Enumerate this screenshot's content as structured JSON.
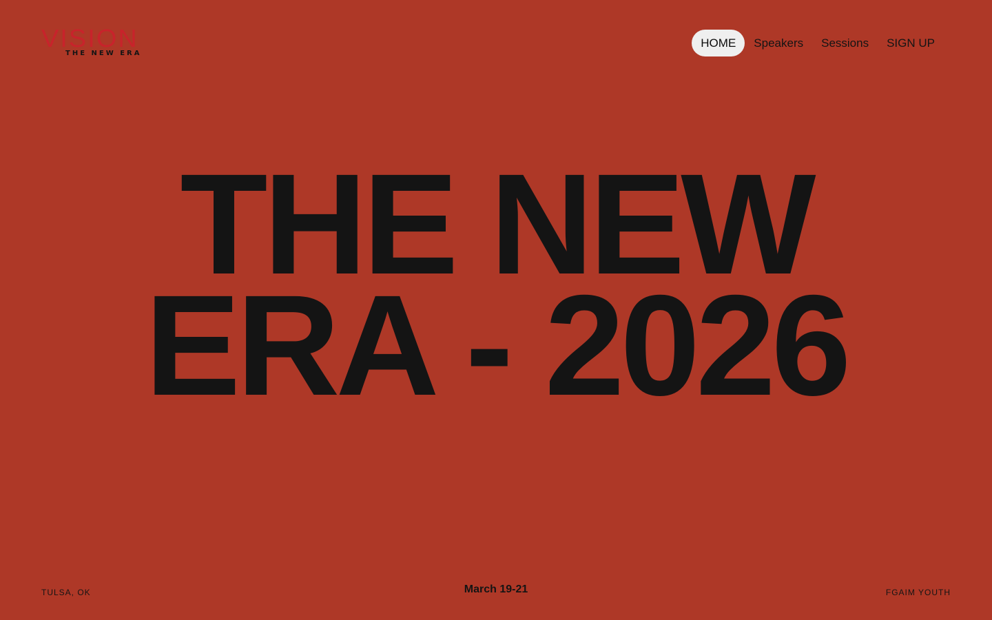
{
  "header": {
    "logo": {
      "word": "VISION",
      "tagline": "THE NEW ERA"
    },
    "nav": [
      {
        "label": "HOME",
        "active": true
      },
      {
        "label": "Speakers",
        "active": false
      },
      {
        "label": "Sessions",
        "active": false
      },
      {
        "label": "SIGN UP",
        "active": false
      }
    ]
  },
  "hero": {
    "line1": "THE NEW",
    "line2": "ERA - 2026"
  },
  "footer": {
    "location": "TULSA, OK",
    "dates": "March 19-21",
    "organizer": "FGAIM YOUTH"
  },
  "colors": {
    "background": "#ae3827",
    "logo": "#c8232b",
    "text": "#141414",
    "nav_active_bg": "#efefef"
  }
}
